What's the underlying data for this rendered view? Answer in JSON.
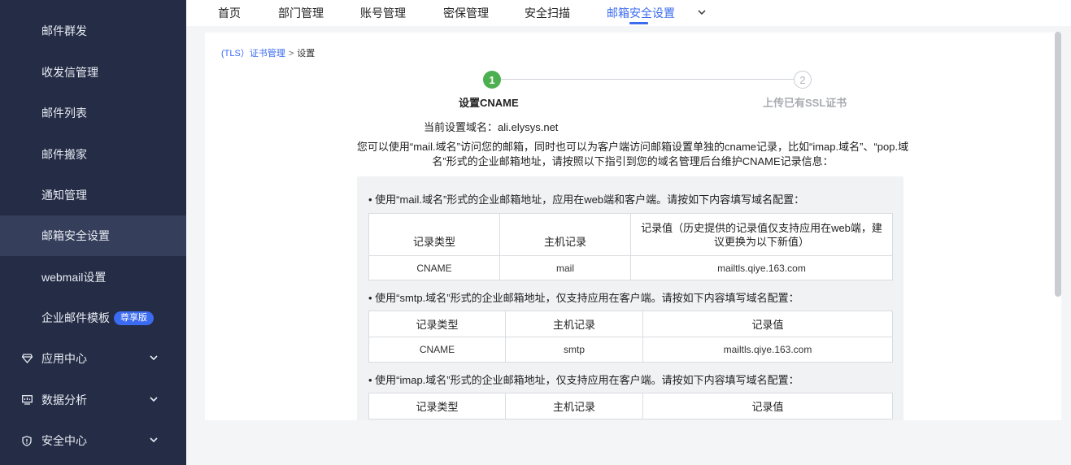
{
  "sidebar": {
    "items": [
      {
        "label": "邮件群发"
      },
      {
        "label": "收发信管理"
      },
      {
        "label": "邮件列表"
      },
      {
        "label": "邮件搬家"
      },
      {
        "label": "通知管理"
      },
      {
        "label": "邮箱安全设置"
      },
      {
        "label": "webmail设置"
      },
      {
        "label": "企业邮件模板",
        "badge": "尊享版"
      }
    ],
    "groups": [
      {
        "label": "应用中心",
        "icon": "diamond-icon"
      },
      {
        "label": "数据分析",
        "icon": "monitor-icon"
      },
      {
        "label": "安全中心",
        "icon": "shield-icon"
      }
    ]
  },
  "topnav": {
    "tabs": [
      {
        "label": "首页"
      },
      {
        "label": "部门管理"
      },
      {
        "label": "账号管理"
      },
      {
        "label": "密保管理"
      },
      {
        "label": "安全扫描"
      },
      {
        "label": "邮箱安全设置"
      }
    ],
    "accent": "#3a6bf0"
  },
  "breadcrumb": {
    "link": "(TLS）证书管理",
    "sep": ">",
    "current": "设置"
  },
  "steps": [
    {
      "num": "1",
      "label": "设置CNAME"
    },
    {
      "num": "2",
      "label": "上传已有SSL证书"
    }
  ],
  "domain_line": "当前设置域名：ali.elysys.net",
  "description": "您可以使用“mail.域名”访问您的邮箱，同时也可以为客户端访问邮箱设置单独的cname记录，比如“imap.域名”、“pop.域名”形式的企业邮箱地址，请按照以下指引到您的域名管理后台维护CNAME记录信息：",
  "sections": [
    {
      "bullet": "• 使用“mail.域名”形式的企业邮箱地址，应用在web端和客户端。请按如下内容填写域名配置：",
      "headers": [
        "记录类型",
        "主机记录",
        "记录值（历史提供的记录值仅支持应用在web端，建议更换为以下新值）"
      ],
      "row": [
        "CNAME",
        "mail",
        "mailtls.qiye.163.com"
      ]
    },
    {
      "bullet": "• 使用“smtp.域名”形式的企业邮箱地址，仅支持应用在客户端。请按如下内容填写域名配置：",
      "headers": [
        "记录类型",
        "主机记录",
        "记录值"
      ],
      "row": [
        "CNAME",
        "smtp",
        "mailtls.qiye.163.com"
      ]
    },
    {
      "bullet": "• 使用“imap.域名”形式的企业邮箱地址，仅支持应用在客户端。请按如下内容填写域名配置：",
      "headers": [
        "记录类型",
        "主机记录",
        "记录值"
      ]
    }
  ]
}
